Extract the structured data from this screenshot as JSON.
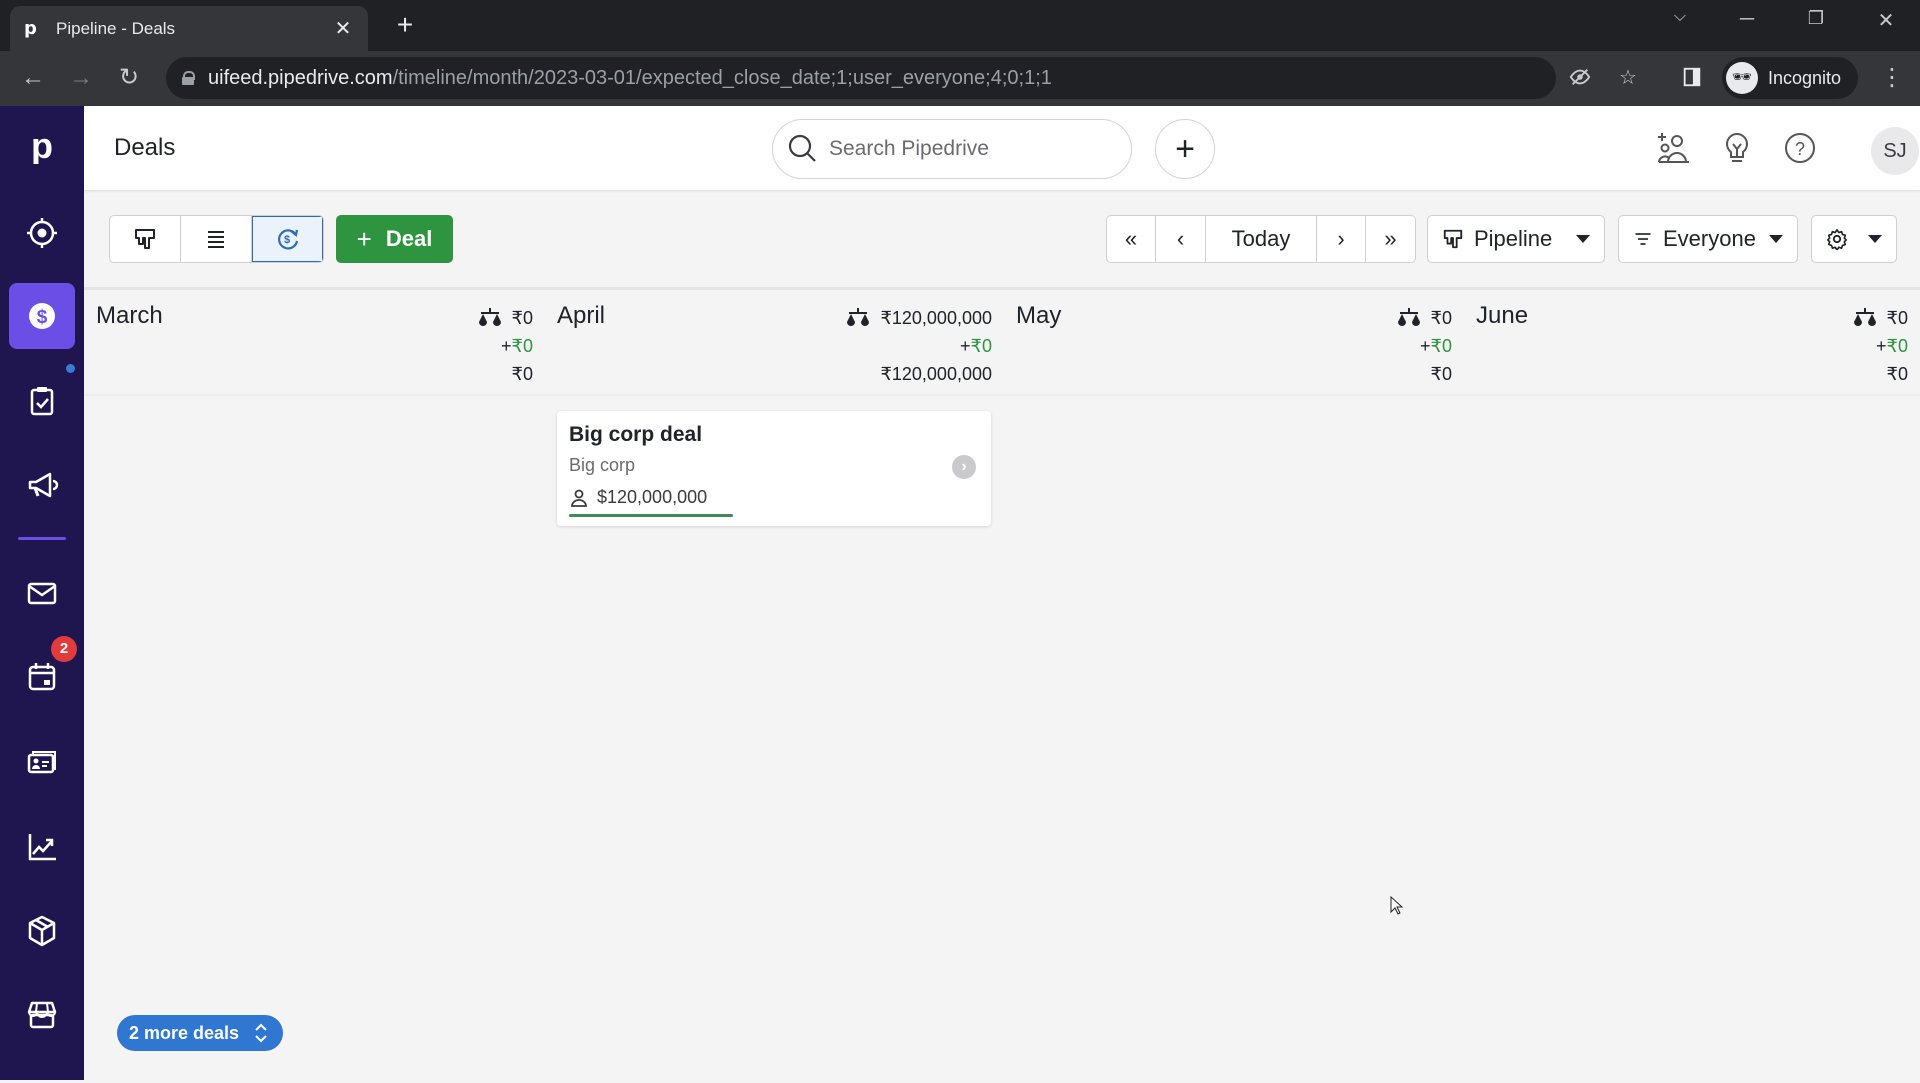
{
  "browser": {
    "tab_title": "Pipeline - Deals",
    "favicon": "p",
    "url_host": "uifeed.pipedrive.com",
    "url_path": "/timeline/month/2023-03-01/expected_close_date;1;user_everyone;4;0;1;1",
    "profile_label": "Incognito"
  },
  "header": {
    "title": "Deals",
    "search_placeholder": "Search Pipedrive",
    "avatar_initials": "SJ"
  },
  "sidebar": {
    "items": [
      {
        "name": "leads",
        "icon": "target-icon"
      },
      {
        "name": "deals",
        "icon": "dollar-icon",
        "active": true
      },
      {
        "name": "activities",
        "icon": "clipboard-check-icon"
      },
      {
        "name": "campaigns",
        "icon": "megaphone-icon"
      },
      {
        "name": "mail",
        "icon": "mail-icon"
      },
      {
        "name": "calendar",
        "icon": "calendar-icon",
        "badge": "2"
      },
      {
        "name": "contacts",
        "icon": "contact-card-icon"
      },
      {
        "name": "insights",
        "icon": "chart-trend-icon"
      },
      {
        "name": "products",
        "icon": "box-icon"
      },
      {
        "name": "marketplace",
        "icon": "store-icon"
      }
    ],
    "calendar_badge": "2"
  },
  "toolbar": {
    "add_deal_label": "Deal",
    "today_label": "Today",
    "pipeline_label": "Pipeline",
    "owner_filter_label": "Everyone"
  },
  "colors": {
    "sidebar_bg": "#1f1650",
    "sidebar_active": "#6b4ee6",
    "primary_green": "#2e9440",
    "accent_blue": "#2f77d1"
  },
  "months": [
    {
      "name": "March",
      "weighted": "₹0",
      "plus_prefix": "+",
      "plus_value": "₹0",
      "total": "₹0"
    },
    {
      "name": "April",
      "weighted": "₹120,000,000",
      "plus_prefix": "+",
      "plus_value": "₹0",
      "total": "₹120,000,000"
    },
    {
      "name": "May",
      "weighted": "₹0",
      "plus_prefix": "+",
      "plus_value": "₹0",
      "total": "₹0"
    },
    {
      "name": "June",
      "weighted": "₹0",
      "plus_prefix": "+",
      "plus_value": "₹0",
      "total": "₹0"
    }
  ],
  "deals": [
    {
      "title": "Big corp deal",
      "organization": "Big corp",
      "value": "$120,000,000",
      "month": "April"
    }
  ],
  "more_deals_label": "2 more deals"
}
